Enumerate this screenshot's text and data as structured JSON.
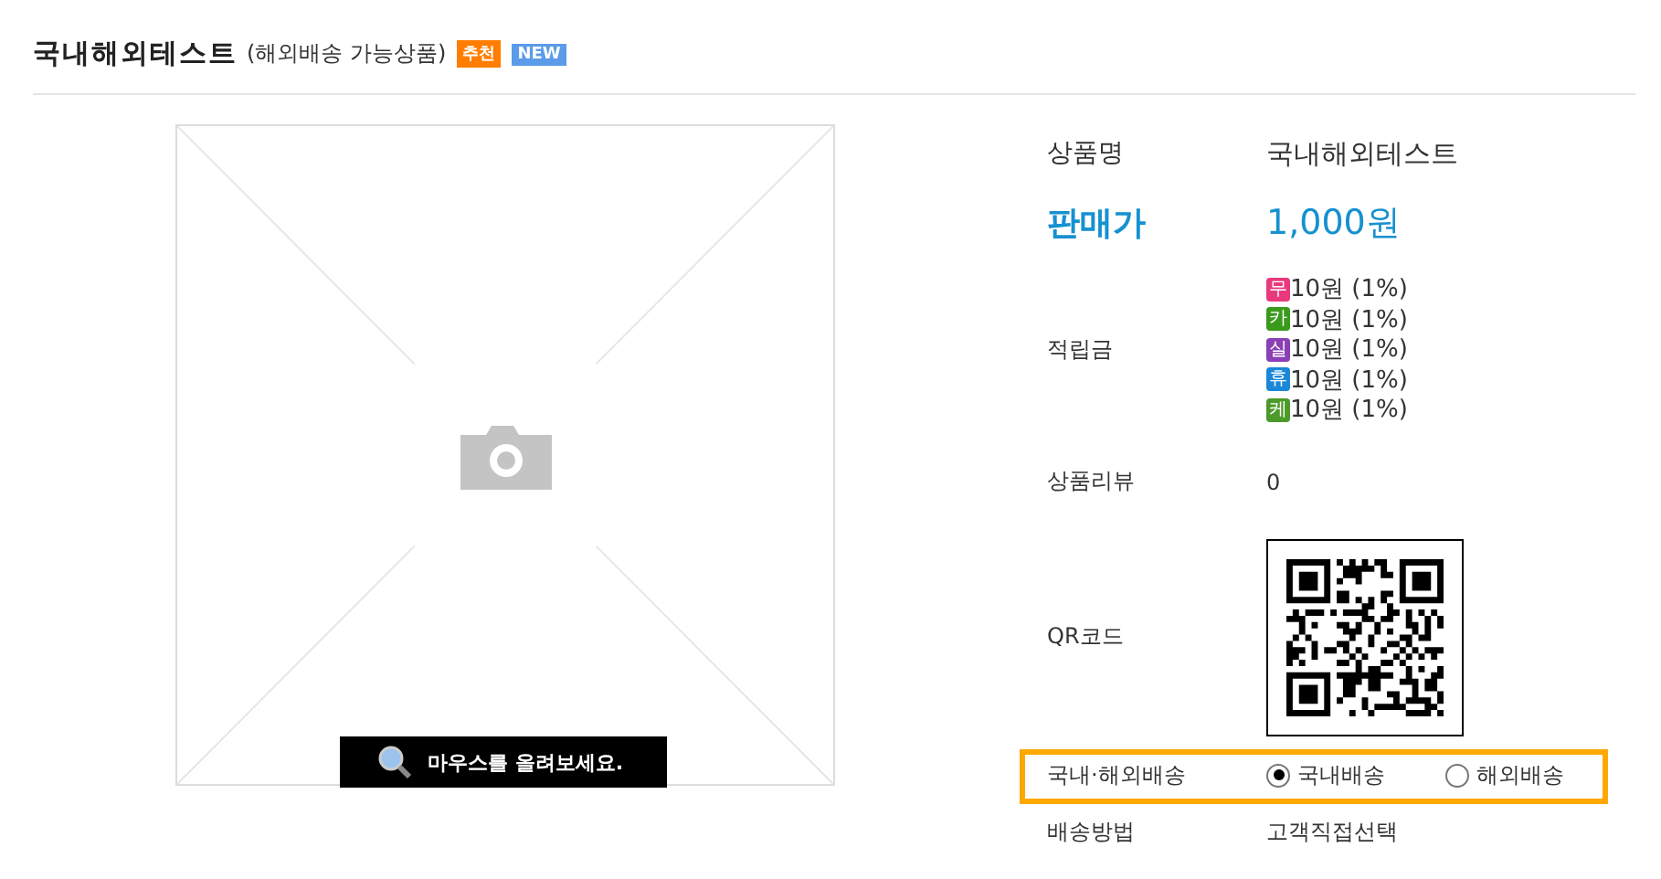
{
  "header": {
    "title": "국내해외테스트",
    "subtitle": "(해외배송 가능상품)",
    "badges": [
      {
        "text": "추천",
        "color": "#ff7e00"
      },
      {
        "text": "NEW",
        "color": "#5b9bea"
      }
    ]
  },
  "image": {
    "hover_hint": "마우스를 올려보세요."
  },
  "details": [
    {
      "kind": "text",
      "label": "상품명",
      "value": "국내해외테스트"
    },
    {
      "kind": "price",
      "label": "판매가",
      "value": "1,000원"
    },
    {
      "kind": "points",
      "label": "적립금",
      "items": [
        {
          "icon": "무",
          "color": "#e8397d",
          "text": "10원 (1%)"
        },
        {
          "icon": "카",
          "color": "#3a9a1c",
          "text": "10원 (1%)"
        },
        {
          "icon": "실",
          "color": "#8a3fb5",
          "text": "10원 (1%)"
        },
        {
          "icon": "휴",
          "color": "#1b87d8",
          "text": "10원 (1%)"
        },
        {
          "icon": "케",
          "color": "#4b9a2a",
          "text": "10원 (1%)"
        }
      ]
    },
    {
      "kind": "text",
      "label": "상품리뷰",
      "value": "0"
    },
    {
      "kind": "qr",
      "label": "QR코드"
    },
    {
      "kind": "radio",
      "label": "국내·해외배송",
      "highlighted": true,
      "options": [
        {
          "label": "국내배송",
          "selected": true
        },
        {
          "label": "해외배송",
          "selected": false
        }
      ]
    },
    {
      "kind": "text",
      "label": "배송방법",
      "value": "고객직접선택"
    }
  ]
}
